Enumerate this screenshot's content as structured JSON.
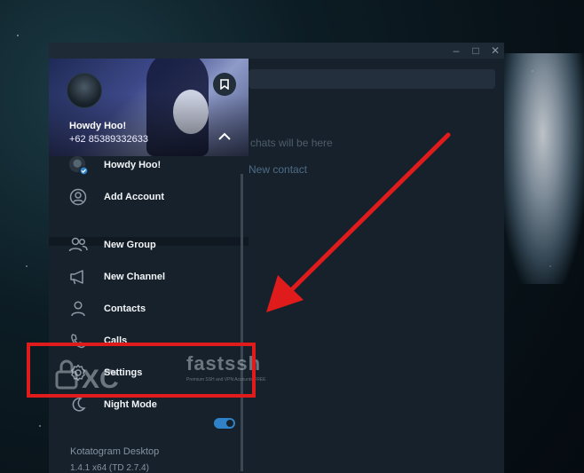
{
  "chat": {
    "hint": "chats will be here",
    "new_contact": "New contact"
  },
  "profile": {
    "name": "Howdy Hoo!",
    "phone": "+62 85389332633"
  },
  "menu": {
    "items": [
      {
        "label": "Howdy Hoo!",
        "icon": "account-avatar-icon"
      },
      {
        "label": "Add Account",
        "icon": "add-account-icon"
      },
      {
        "label": "New Group",
        "icon": "group-icon"
      },
      {
        "label": "New Channel",
        "icon": "megaphone-icon"
      },
      {
        "label": "Contacts",
        "icon": "person-icon"
      },
      {
        "label": "Calls",
        "icon": "phone-icon"
      },
      {
        "label": "Settings",
        "icon": "gear-icon"
      },
      {
        "label": "Night Mode",
        "icon": "moon-icon"
      }
    ],
    "night_mode_on": true
  },
  "app": {
    "name": "Kotatogram Desktop",
    "version": "1.4.1 x64 (TD 2.7.4)"
  },
  "watermark": {
    "text": "fastssh",
    "subtext": "Premium SSH and VPN Accounts FREE"
  },
  "colors": {
    "annotation": "#e01b1b",
    "accent": "#2f82c7",
    "panel": "#17212b"
  }
}
